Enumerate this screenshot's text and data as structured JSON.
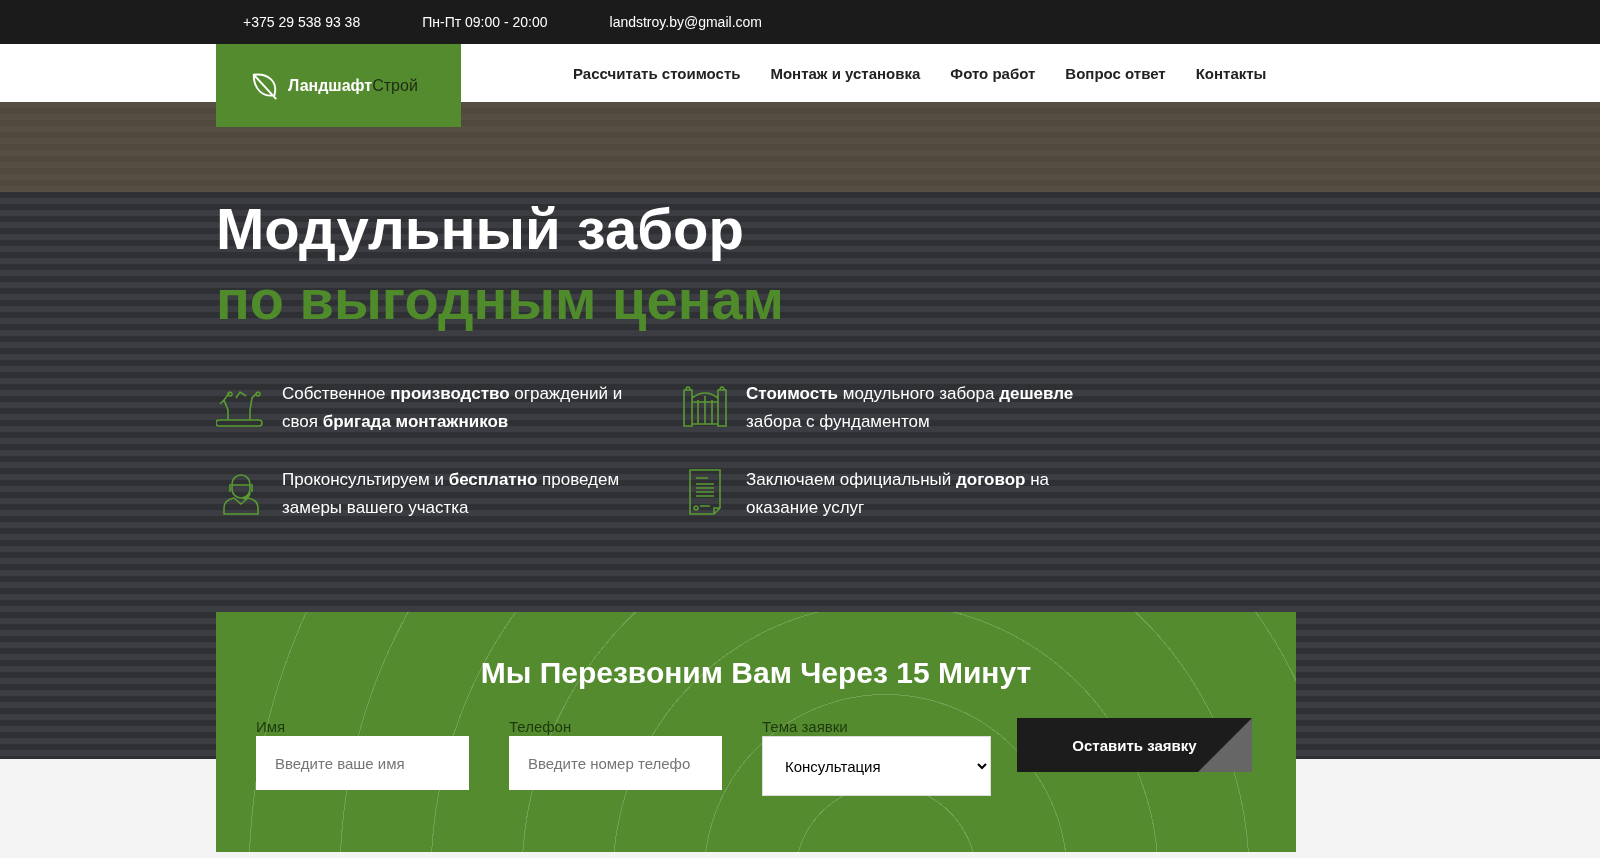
{
  "top_bar": {
    "phone": "+375 29 538 93 38",
    "hours": "Пн-Пт 09:00 - 20:00",
    "email": "landstroy.by@gmail.com"
  },
  "logo": {
    "text": "Ландшафт",
    "accent": "Строй"
  },
  "nav": [
    "Рассчитать стоимость",
    "Монтаж и установка",
    "Фото работ",
    "Вопрос ответ",
    "Контакты"
  ],
  "hero": {
    "title": "Модульный забор",
    "subtitle": "по выгодным ценам"
  },
  "features": [
    {
      "kind": "production",
      "text": "Собственное **производство** ограждений и своя **бригада монтажников**"
    },
    {
      "kind": "gate",
      "text": "**Стоимость** модульного забора **дешевле** забора с фундаментом"
    },
    {
      "kind": "consultant",
      "text": "Проконсультируем и **бесплатно** проведем замеры вашего участка"
    },
    {
      "kind": "contract",
      "text": "Заключаем официальный **договор** на оказание услуг"
    }
  ],
  "form": {
    "title": "Мы Перезвоним Вам Через 15 Минут",
    "fields": [
      {
        "kind": "input",
        "label": "Имя",
        "placeholder": "Введите ваше имя"
      },
      {
        "kind": "input",
        "label": "Телефон",
        "placeholder": "Введите номер телефо"
      },
      {
        "kind": "select",
        "label": "Тема заявки",
        "value": "Консультация"
      }
    ],
    "button": "Оставить заявку"
  }
}
